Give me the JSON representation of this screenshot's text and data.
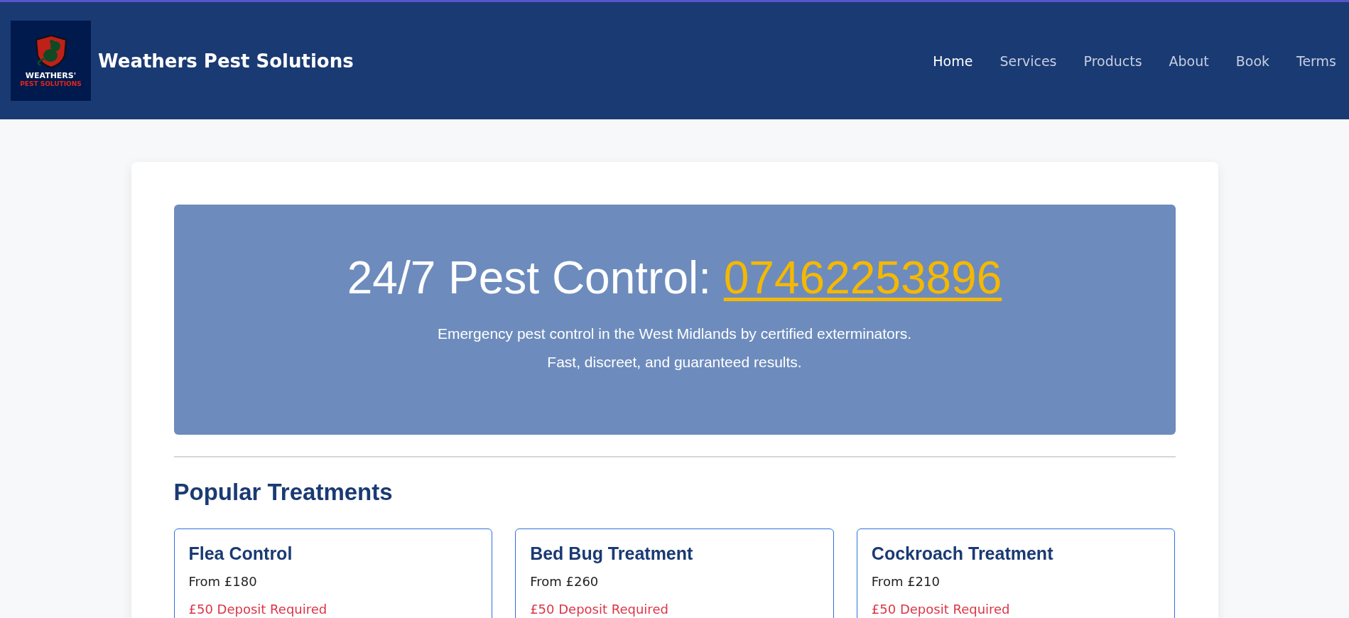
{
  "header": {
    "logo": {
      "name": "WEATHERS'",
      "tagline": "PEST SOLUTIONS"
    },
    "brand": "Weathers Pest Solutions",
    "nav": [
      {
        "label": "Home",
        "selected": true
      },
      {
        "label": "Services",
        "selected": false
      },
      {
        "label": "Products",
        "selected": false
      },
      {
        "label": "About",
        "selected": false
      },
      {
        "label": "Book",
        "selected": false
      },
      {
        "label": "Terms",
        "selected": false
      }
    ]
  },
  "hero": {
    "title": "24/7 Pest Control:",
    "phone": "07462253896",
    "lines": [
      "Emergency pest control in the West Midlands by certified exterminators.",
      "Fast, discreet, and guaranteed results."
    ]
  },
  "treatments": {
    "heading": "Popular Treatments",
    "items": [
      {
        "name": "Flea Control",
        "price": "From £180",
        "deposit": "£50 Deposit Required"
      },
      {
        "name": "Bed Bug Treatment",
        "price": "From £260",
        "deposit": "£50 Deposit Required"
      },
      {
        "name": "Cockroach Treatment",
        "price": "From £210",
        "deposit": "£50 Deposit Required"
      }
    ]
  }
}
